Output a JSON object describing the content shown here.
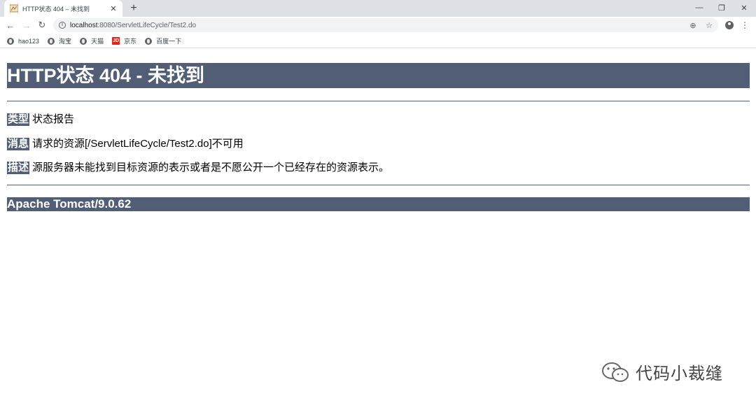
{
  "browser": {
    "tab": {
      "title": "HTTP状态 404 – 未找到",
      "close_glyph": "✕",
      "favicon": "tomcat-favicon-icon"
    },
    "new_tab_glyph": "+",
    "window_controls": {
      "minimize": "—",
      "restore": "❐",
      "close": "✕"
    },
    "toolbar": {
      "back_glyph": "←",
      "forward_glyph": "→",
      "reload_glyph": "↻",
      "url_host": "localhost",
      "url_path": ":8080/ServletLifeCycle/Test2.do",
      "zoom_glyph": "⊕",
      "star_glyph": "☆",
      "menu_glyph": "⋮"
    },
    "bookmarks": [
      {
        "label": "hao123",
        "icon": "globe-icon"
      },
      {
        "label": "淘宝",
        "icon": "globe-icon"
      },
      {
        "label": "天猫",
        "icon": "globe-icon"
      },
      {
        "label": "京东",
        "icon": "jd-icon",
        "icon_text": "JD"
      },
      {
        "label": "百度一下",
        "icon": "globe-icon"
      }
    ]
  },
  "page": {
    "heading": "HTTP状态 404 - 未找到",
    "rows": [
      {
        "label": "类型",
        "value": "状态报告"
      },
      {
        "label": "消息",
        "value": "请求的资源[/ServletLifeCycle/Test2.do]不可用"
      },
      {
        "label": "描述",
        "value": "源服务器未能找到目标资源的表示或者是不愿公开一个已经存在的资源表示。"
      }
    ],
    "footer": "Apache Tomcat/9.0.62"
  },
  "watermark": {
    "text": "代码小裁缝"
  },
  "colors": {
    "tomcat_header": "#525d76",
    "tab_strip": "#dee1e6",
    "omnibox": "#f1f3f4",
    "jd_red": "#e1251b"
  }
}
